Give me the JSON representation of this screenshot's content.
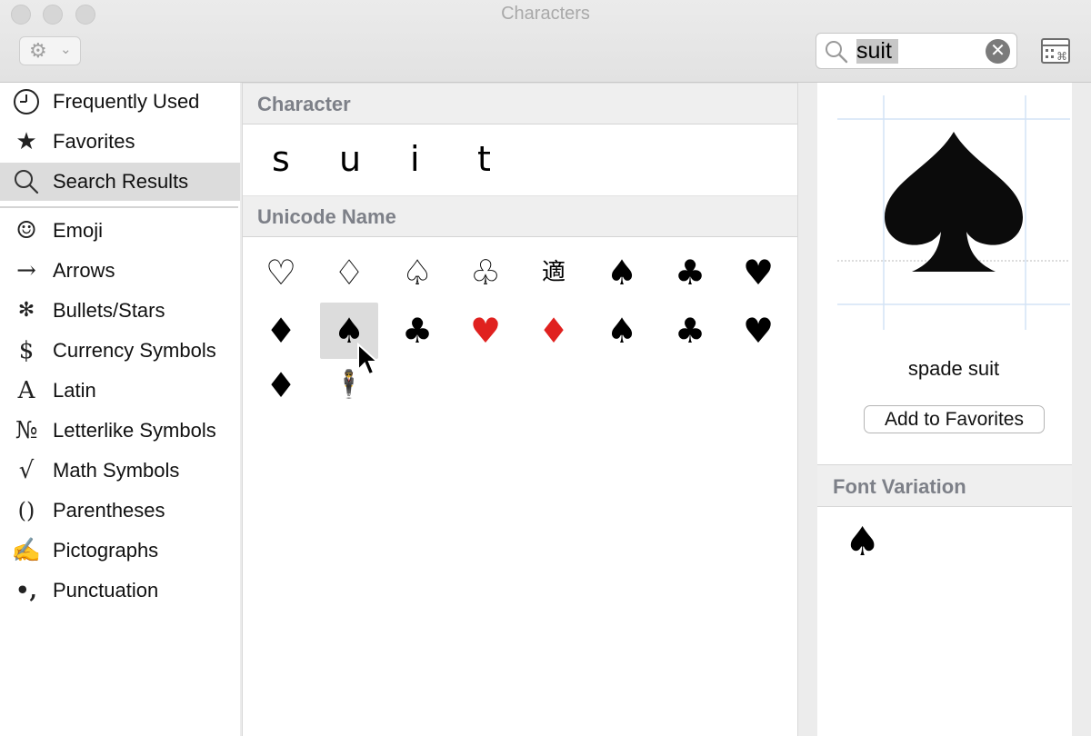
{
  "window": {
    "title": "Characters"
  },
  "toolbar": {
    "gear_icon": "gear-icon",
    "dropdown_glyph": "⌄"
  },
  "search": {
    "value": "suit",
    "clear_glyph": "✕"
  },
  "sidebar": {
    "items": [
      {
        "label": "Frequently Used",
        "icon": "clock-icon",
        "glyph": "🕘"
      },
      {
        "label": "Favorites",
        "icon": "star-icon",
        "glyph": "★"
      },
      {
        "label": "Search Results",
        "icon": "search-icon",
        "glyph": ""
      },
      {
        "label": "Emoji",
        "icon": "smiley-icon",
        "glyph": "☺"
      },
      {
        "label": "Arrows",
        "icon": "arrow-icon",
        "glyph": "→"
      },
      {
        "label": "Bullets/Stars",
        "icon": "asterisk-icon",
        "glyph": "✻"
      },
      {
        "label": "Currency Symbols",
        "icon": "dollar-icon",
        "glyph": "$"
      },
      {
        "label": "Latin",
        "icon": "latin-a-icon",
        "glyph": "A"
      },
      {
        "label": "Letterlike Symbols",
        "icon": "numero-icon",
        "glyph": "№"
      },
      {
        "label": "Math Symbols",
        "icon": "sqrt-icon",
        "glyph": "√"
      },
      {
        "label": "Parentheses",
        "icon": "parentheses-icon",
        "glyph": "()"
      },
      {
        "label": "Pictographs",
        "icon": "writing-hand-icon",
        "glyph": "✍"
      },
      {
        "label": "Punctuation",
        "icon": "punctuation-icon",
        "glyph": "•,"
      }
    ]
  },
  "center": {
    "character_header": "Character",
    "characters": [
      "s",
      "u",
      "i",
      "t"
    ],
    "unicode_header": "Unicode Name",
    "glyphs": [
      {
        "char": "♡",
        "color": "#000000",
        "name": "white-heart-suit"
      },
      {
        "char": "♢",
        "color": "#000000",
        "name": "white-diamond-suit"
      },
      {
        "char": "♤",
        "color": "#000000",
        "name": "white-spade-suit"
      },
      {
        "char": "♧",
        "color": "#000000",
        "name": "white-club-suit"
      },
      {
        "char": "適",
        "color": "#000000",
        "name": "circled-ideograph-suitable"
      },
      {
        "char": "♠",
        "color": "#000000",
        "name": "black-spade-suit"
      },
      {
        "char": "♣",
        "color": "#000000",
        "name": "black-club-suit"
      },
      {
        "char": "♥",
        "color": "#000000",
        "name": "black-heart-suit"
      },
      {
        "char": "♦",
        "color": "#000000",
        "name": "black-diamond-suit"
      },
      {
        "char": "♠",
        "color": "#000000",
        "name": "spade-suit-emoji"
      },
      {
        "char": "♣",
        "color": "#000000",
        "name": "club-suit-emoji"
      },
      {
        "char": "♥",
        "color": "#e0211f",
        "name": "heart-suit-emoji"
      },
      {
        "char": "♦",
        "color": "#e0211f",
        "name": "diamond-suit-emoji"
      },
      {
        "char": "♠",
        "color": "#000000",
        "name": "spade-suit"
      },
      {
        "char": "♣",
        "color": "#000000",
        "name": "club-suit"
      },
      {
        "char": "♥",
        "color": "#000000",
        "name": "heart-suit"
      },
      {
        "char": "♦",
        "color": "#000000",
        "name": "diamond-suit"
      },
      {
        "char": "🕴",
        "color": "#000000",
        "name": "man-in-business-suit-levitating"
      }
    ],
    "selected_index": 9
  },
  "detail": {
    "name": "spade suit",
    "add_favorites": "Add to Favorites",
    "font_variation_header": "Font Variation",
    "variation_glyph": "♠"
  }
}
